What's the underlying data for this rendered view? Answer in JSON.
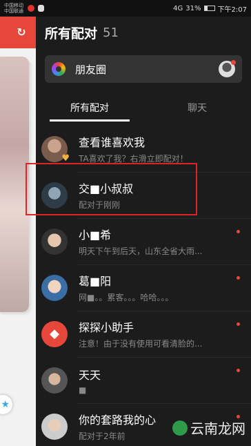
{
  "statusbar": {
    "carrier_line1": "中国移动",
    "carrier_line2": "中国联通",
    "signal": "4G",
    "battery": "31%",
    "time": "下午2:07"
  },
  "leftpanel": {
    "header_icon": "refresh-icon",
    "bottom_icon": "star-icon"
  },
  "header": {
    "title": "所有配对",
    "count": "51"
  },
  "moments": {
    "icon": "moments-color-icon",
    "label": "朋友圈"
  },
  "tabs": [
    {
      "label": "所有配对",
      "active": true
    },
    {
      "label": "聊天",
      "active": false
    }
  ],
  "matches": [
    {
      "name": "查看谁喜欢我",
      "subtitle": "TA喜欢了我？右滑立即配对！",
      "unread": false,
      "badge": "heart-icon"
    },
    {
      "name": "交■小叔叔",
      "subtitle": "配对于刚刚",
      "unread": false
    },
    {
      "name": "小■希",
      "subtitle": "明天下午到后天，山东全省大雨...",
      "unread": true
    },
    {
      "name": "葛■阳",
      "subtitle": "网■。。累客。。。哈哈。。。",
      "unread": true
    },
    {
      "name": "探探小助手",
      "subtitle": "注意！由于没有使用可看清脸的...",
      "unread": true
    },
    {
      "name": "天天",
      "subtitle": "■",
      "unread": true
    },
    {
      "name": "你的套路我的心",
      "subtitle": "配对于2年前",
      "unread": true
    }
  ],
  "highlight_target": "交■小叔叔",
  "watermark": "云南龙网",
  "colors": {
    "accent": "#e6473a",
    "background": "#1c1c1c",
    "highlight_box": "#e02424"
  }
}
